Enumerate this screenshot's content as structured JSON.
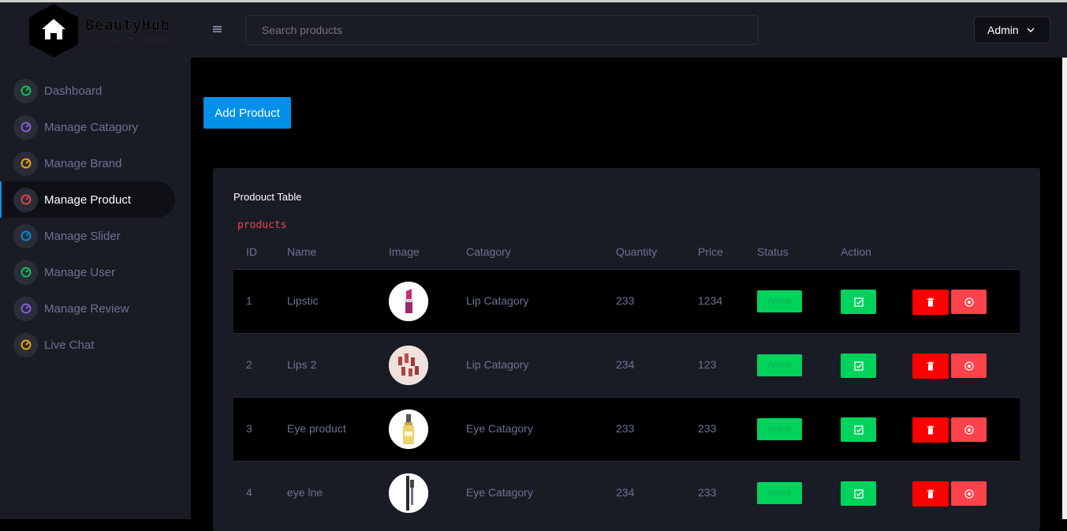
{
  "brand": {
    "name": "BeautyHub",
    "tagline": "ONLINE SHOPPING"
  },
  "header": {
    "menu_icon": "hamburger-icon",
    "search_placeholder": "Search products",
    "admin_label": "Admin"
  },
  "sidebar": {
    "items": [
      {
        "label": "Dashboard",
        "icon_color": "#00d25b",
        "active": false
      },
      {
        "label": "Manage Catagory",
        "icon_color": "#8f5fe8",
        "active": false
      },
      {
        "label": "Manage Brand",
        "icon_color": "#ffab00",
        "active": false
      },
      {
        "label": "Manage Product",
        "icon_color": "#fc424a",
        "active": true
      },
      {
        "label": "Manage Slider",
        "icon_color": "#0090e7",
        "active": false
      },
      {
        "label": "Manage User",
        "icon_color": "#00d25b",
        "active": false
      },
      {
        "label": "Manage Review",
        "icon_color": "#8f5fe8",
        "active": false
      },
      {
        "label": "Live Chat",
        "icon_color": "#ffab00",
        "active": false
      }
    ]
  },
  "main": {
    "add_button": "Add Product",
    "card_title": "Prodouct Table",
    "card_subtitle": "products",
    "columns": [
      "ID",
      "Name",
      "Image",
      "Catagory",
      "Quantity",
      "Price",
      "Status",
      "Action"
    ],
    "rows": [
      {
        "id": "1",
        "name": "Lipstic",
        "category": "Lip Catagory",
        "quantity": "233",
        "price": "1234",
        "status": "Active",
        "image": "lipstick"
      },
      {
        "id": "2",
        "name": "Lips 2",
        "category": "Lip Catagory",
        "quantity": "234",
        "price": "123",
        "status": "Active",
        "image": "lipsticks-set"
      },
      {
        "id": "3",
        "name": "Eye product",
        "category": "Eye Catagory",
        "quantity": "233",
        "price": "233",
        "status": "Active",
        "image": "serum-bottle"
      },
      {
        "id": "4",
        "name": "eye lne",
        "category": "Eye Catagory",
        "quantity": "234",
        "price": "233",
        "status": "Active",
        "image": "eyeliner"
      }
    ]
  },
  "colors": {
    "accent": "#0090e7",
    "success": "#00d25b",
    "danger": "#ff0000",
    "danger_light": "#fc424a",
    "panel": "#191c24"
  }
}
